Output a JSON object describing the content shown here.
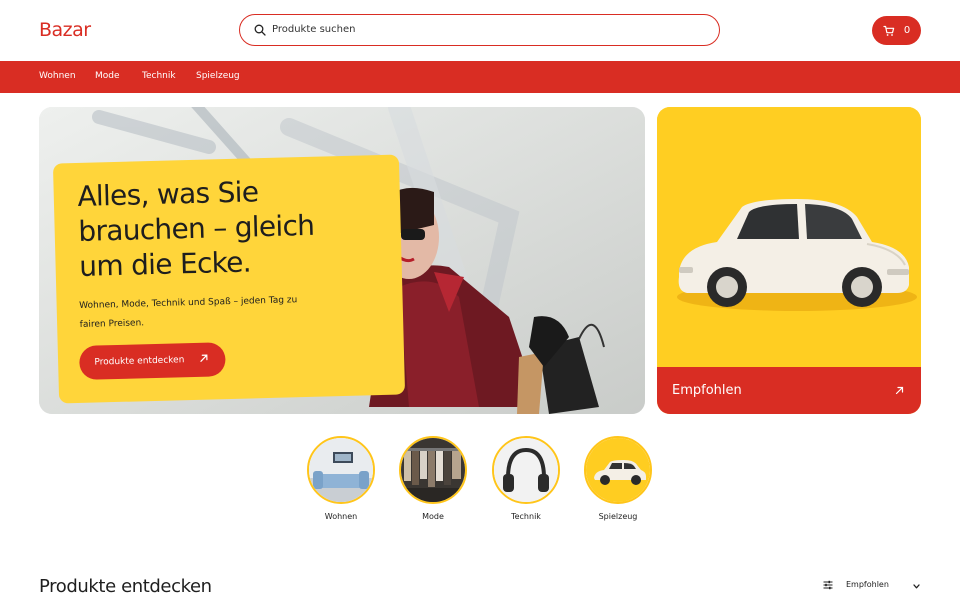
{
  "header": {
    "logo": "Bazar",
    "search_placeholder": "Produkte suchen",
    "cart_count": "0",
    "icons": {
      "search": "search-icon",
      "cart": "cart-icon"
    }
  },
  "nav": {
    "items": [
      {
        "label": "Wohnen"
      },
      {
        "label": "Mode"
      },
      {
        "label": "Technik"
      },
      {
        "label": "Spielzeug"
      }
    ]
  },
  "hero": {
    "title": "Alles, was Sie brauchen – gleich um die Ecke.",
    "subtitle": "Wohnen, Mode, Technik und Spaß – jeden Tag zu fairen Preisen.",
    "cta_label": "Produkte entdecken"
  },
  "featured": {
    "label": "Empfohlen"
  },
  "categories": [
    {
      "label": "Wohnen"
    },
    {
      "label": "Mode"
    },
    {
      "label": "Technik"
    },
    {
      "label": "Spielzeug"
    }
  ],
  "products_section": {
    "title": "Produkte entdecken",
    "sort_label": "Empfohlen"
  },
  "colors": {
    "brand_red": "#d92d23",
    "accent_yellow": "#ffd53a"
  }
}
